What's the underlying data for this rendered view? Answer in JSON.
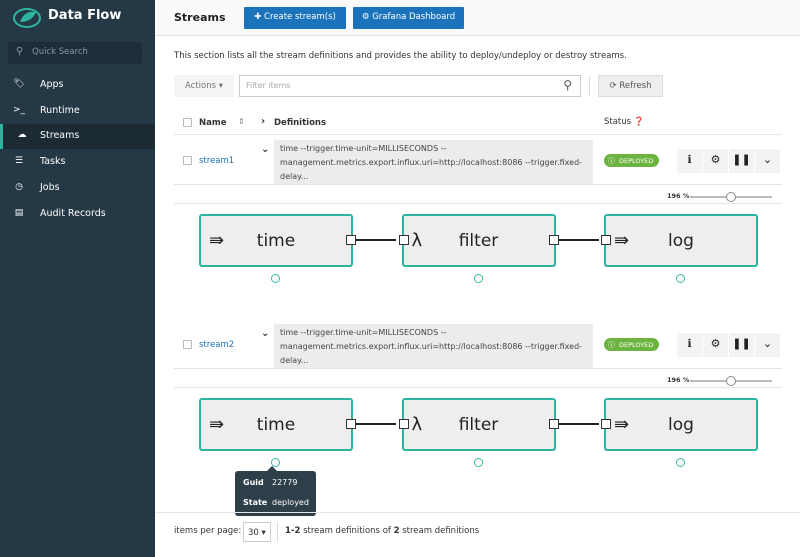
{
  "app": {
    "title": "Data Flow",
    "search_placeholder": "Quick Search"
  },
  "sidebar": {
    "items": [
      {
        "label": "Apps",
        "icon": "tags-icon",
        "glyph": "🏷"
      },
      {
        "label": "Runtime",
        "icon": "terminal-icon",
        "glyph": ">_"
      },
      {
        "label": "Streams",
        "icon": "cloud-icon",
        "glyph": "☁",
        "active": true
      },
      {
        "label": "Tasks",
        "icon": "tasks-icon",
        "glyph": "☰"
      },
      {
        "label": "Jobs",
        "icon": "clock-icon",
        "glyph": "◷"
      },
      {
        "label": "Audit Records",
        "icon": "audit-icon",
        "glyph": "▤"
      }
    ]
  },
  "header": {
    "title": "Streams",
    "create_label": "Create stream(s)",
    "grafana_label": "Grafana Dashboard"
  },
  "description": "This section lists all the stream definitions and provides the ability to deploy/undeploy or destroy streams.",
  "toolbar": {
    "actions_label": "Actions",
    "filter_placeholder": "Filter items",
    "refresh_label": "Refresh"
  },
  "table": {
    "col_name": "Name",
    "col_definitions": "Definitions",
    "col_status": "Status"
  },
  "streams": [
    {
      "name": "stream1",
      "definition": "time --trigger.time-unit=MILLISECONDS --management.metrics.export.influx.uri=http://localhost:8086 --trigger.fixed-delay...",
      "status": "DEPLOYED",
      "zoom": "196 %",
      "zoom_level": 0.5,
      "nodes": [
        {
          "label": "time",
          "type": "source"
        },
        {
          "label": "filter",
          "type": "processor"
        },
        {
          "label": "log",
          "type": "sink"
        }
      ]
    },
    {
      "name": "stream2",
      "definition": "time --trigger.time-unit=MILLISECONDS --management.metrics.export.influx.uri=http://localhost:8086 --trigger.fixed-delay...",
      "status": "DEPLOYED",
      "zoom": "196 %",
      "zoom_level": 0.5,
      "nodes": [
        {
          "label": "time",
          "type": "source"
        },
        {
          "label": "filter",
          "type": "processor"
        },
        {
          "label": "log",
          "type": "sink"
        }
      ]
    }
  ],
  "tooltip": {
    "guid_label": "Guid",
    "guid": "22779",
    "state_label": "State",
    "state": "deployed"
  },
  "footer": {
    "items_per_page_label": "items per page:",
    "page_size": "30",
    "range": "1-2",
    "text_mid": "stream definitions of",
    "total": "2",
    "text_end": "stream definitions"
  },
  "colors": {
    "accent": "#2bb5a0",
    "primary": "#1b74bb",
    "deployed": "#6db33f",
    "sidebar": "#243845"
  }
}
